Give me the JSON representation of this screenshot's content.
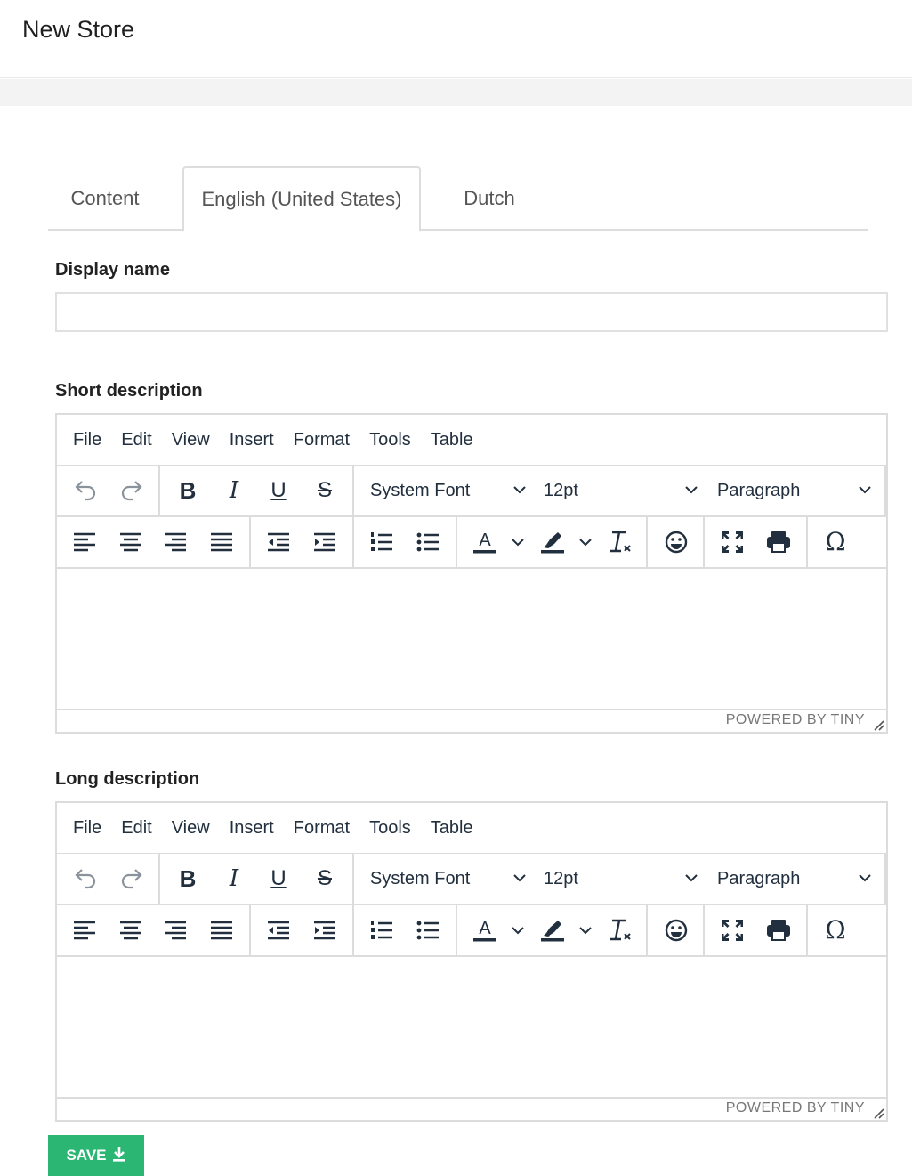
{
  "page": {
    "title": "New Store"
  },
  "tabs": [
    {
      "label": "Content"
    },
    {
      "label": "English (United States)"
    },
    {
      "label": "Dutch"
    }
  ],
  "fields": {
    "display_name": {
      "label": "Display name",
      "value": "",
      "placeholder": ""
    },
    "short_description": {
      "label": "Short description"
    },
    "long_description": {
      "label": "Long description"
    }
  },
  "editor": {
    "menu": [
      "File",
      "Edit",
      "View",
      "Insert",
      "Format",
      "Tools",
      "Table"
    ],
    "font_family": "System Font",
    "font_size": "12pt",
    "block_format": "Paragraph",
    "branding": "POWERED BY TINY",
    "icons": [
      "undo-icon",
      "redo-icon",
      "bold-icon",
      "italic-icon",
      "underline-icon",
      "strikethrough-icon",
      "align-left-icon",
      "align-center-icon",
      "align-right-icon",
      "align-justify-icon",
      "outdent-icon",
      "indent-icon",
      "numbered-list-icon",
      "bullet-list-icon",
      "text-color-icon",
      "highlight-icon",
      "clear-formatting-icon",
      "emoticons-icon",
      "fullscreen-icon",
      "print-icon",
      "special-character-icon"
    ],
    "glyphs": {
      "bold": "B",
      "italic": "I",
      "underline": "U",
      "strike": "S",
      "text_color": "A",
      "omega": "Ω"
    }
  },
  "actions": {
    "save_label": "SAVE"
  },
  "colors": {
    "save_button": "#2bb673",
    "text": "#222f3e"
  }
}
